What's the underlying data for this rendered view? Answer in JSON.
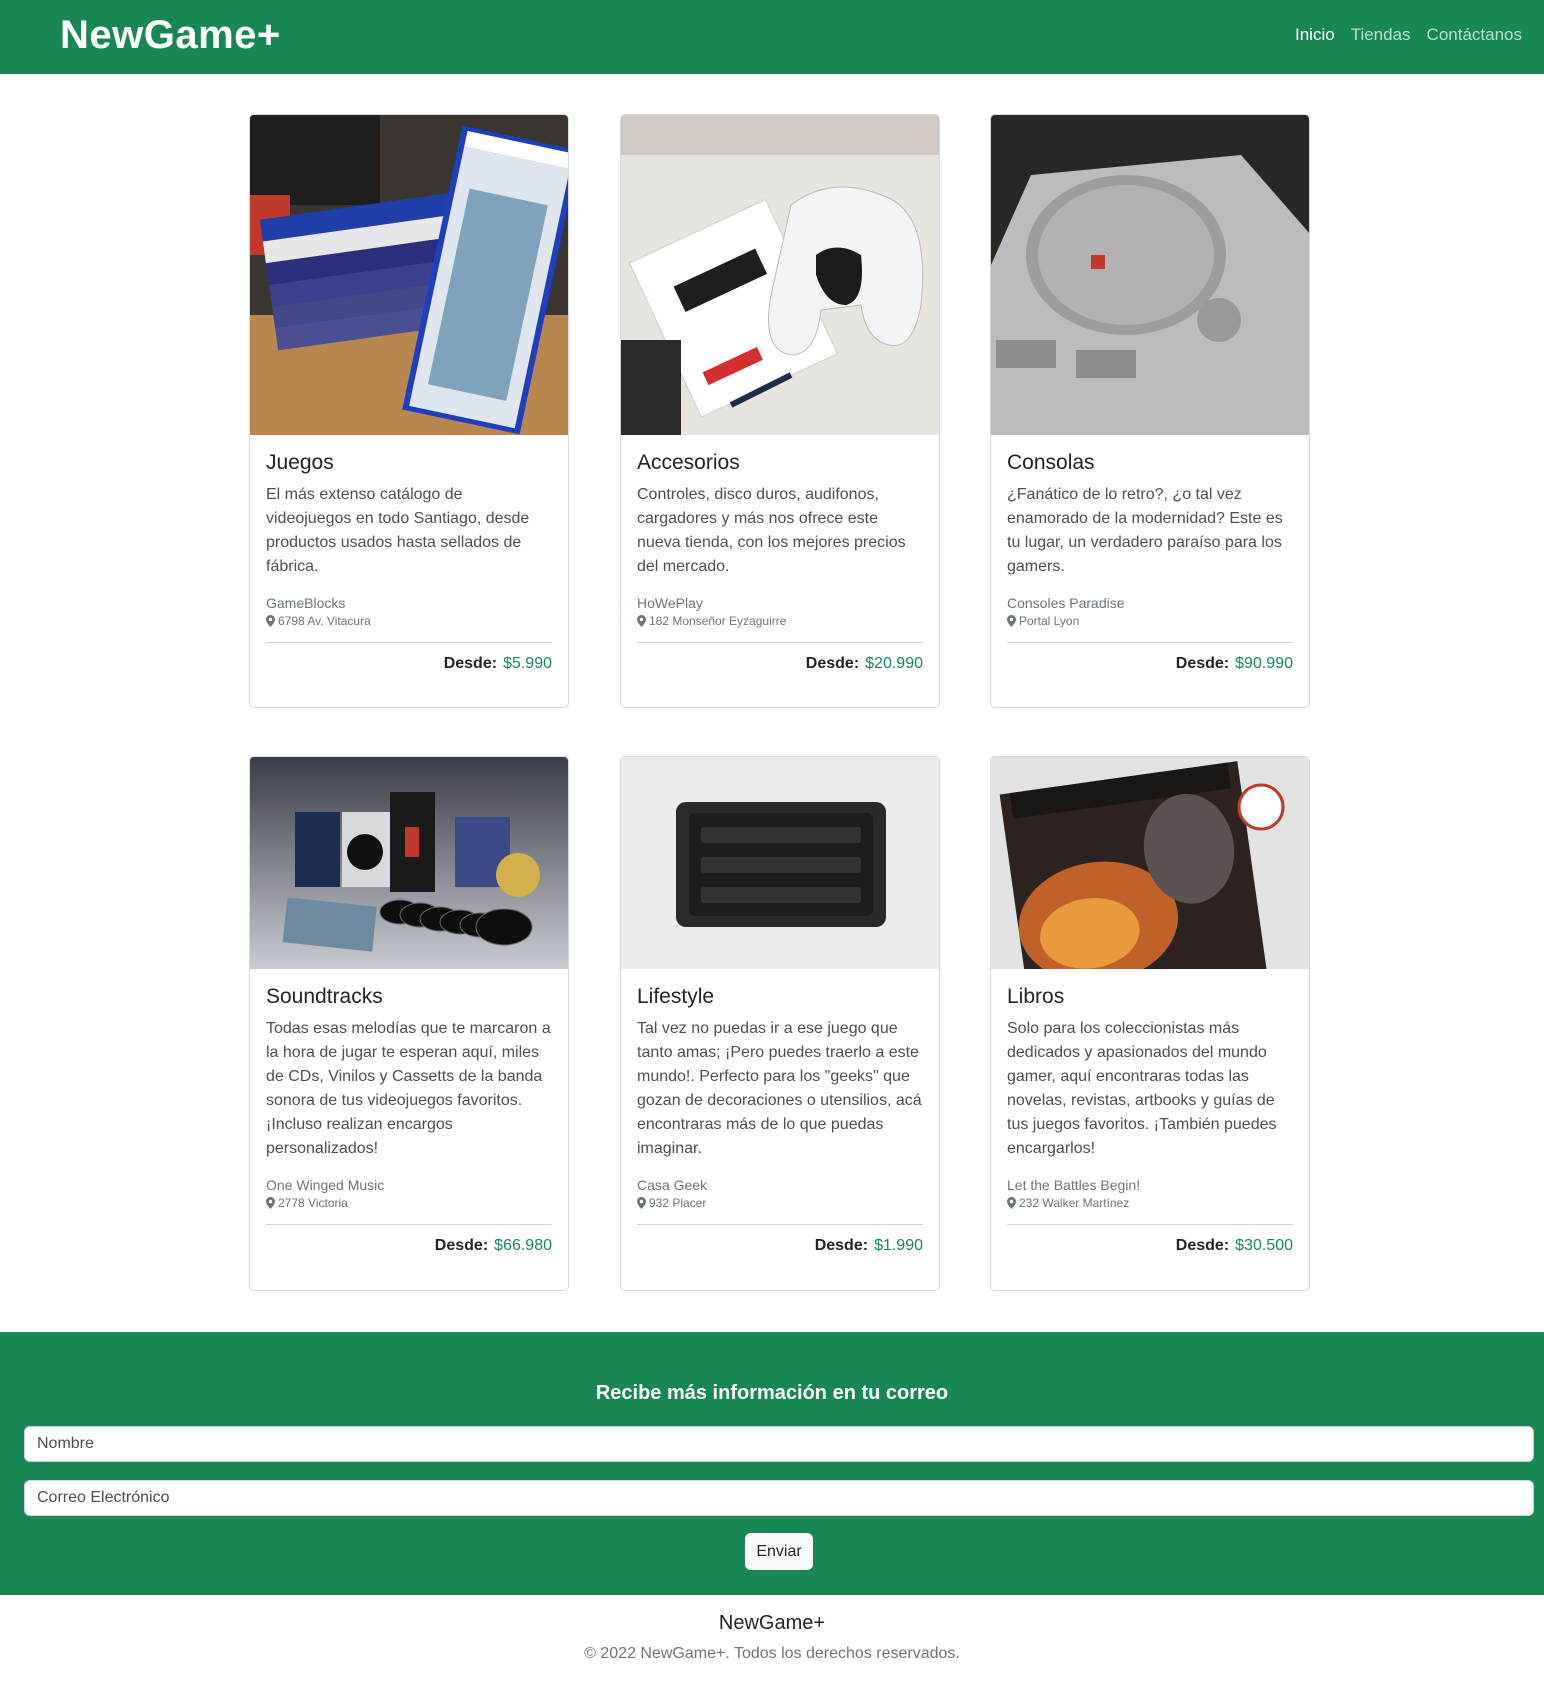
{
  "nav": {
    "brand": "NewGame+",
    "links": [
      {
        "label": "Inicio",
        "active": true
      },
      {
        "label": "Tiendas",
        "active": false
      },
      {
        "label": "Contáctanos",
        "active": false
      }
    ]
  },
  "cards": [
    {
      "title": "Juegos",
      "text": "El más extenso catálogo de videojuegos en todo Santiago, desde productos usados hasta sellados de fábrica.",
      "store": "GameBlocks",
      "address": "6798 Av. Vitacura",
      "price_label": "Desde:",
      "price": "$5.990"
    },
    {
      "title": "Accesorios",
      "text": "Controles, disco duros, audifonos, cargadores y más nos ofrece este nueva tienda, con los mejores precios del mercado.",
      "store": "HoWePlay",
      "address": "182 Monseñor Eyzaguirre",
      "price_label": "Desde:",
      "price": "$20.990"
    },
    {
      "title": "Consolas",
      "text": "¿Fanático de lo retro?, ¿o tal vez enamorado de la modernidad? Este es tu lugar, un verdadero paraíso para los gamers.",
      "store": "Consoles Paradise",
      "address": "Portal Lyon",
      "price_label": "Desde:",
      "price": "$90.990"
    },
    {
      "title": "Soundtracks",
      "text": "Todas esas melodías que te marcaron a la hora de jugar te esperan aquí, miles de CDs, Vinilos y Cassetts de la banda sonora de tus videojuegos favoritos. ¡Incluso realizan encargos personalizados!",
      "store": "One Winged Music",
      "address": "2778 Victoria",
      "price_label": "Desde:",
      "price": "$66.980"
    },
    {
      "title": "Lifestyle",
      "text": "Tal vez no puedas ir a ese juego que tanto amas; ¡Pero puedes traerlo a este mundo!. Perfecto para los \"geeks\" que gozan de decoraciones o utensilios, acá encontraras más de lo que puedas imaginar.",
      "store": "Casa Geek",
      "address": "932 Placer",
      "price_label": "Desde:",
      "price": "$1.990"
    },
    {
      "title": "Libros",
      "text": "Solo para los coleccionistas más dedicados y apasionados del mundo gamer, aquí encontraras todas las novelas, revistas, artbooks y guías de tus juegos favoritos. ¡También puedes encargarlos!",
      "store": "Let the Battles Begin!",
      "address": "232 Walker Martínez",
      "price_label": "Desde:",
      "price": "$30.500"
    }
  ],
  "newsletter": {
    "title": "Recibe más información en tu correo",
    "name_placeholder": "Nombre",
    "email_placeholder": "Correo Electrónico",
    "submit_label": "Enviar"
  },
  "footer": {
    "brand": "NewGame+",
    "copyright": "© 2022 NewGame+. Todos los derechos reservados."
  },
  "colors": {
    "primary": "#198754",
    "price": "#198754"
  }
}
